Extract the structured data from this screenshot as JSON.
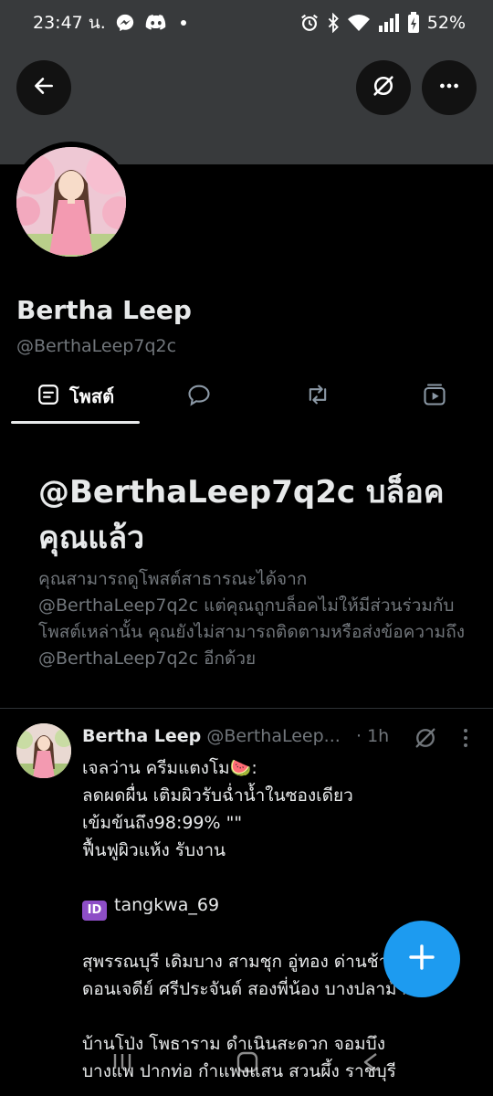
{
  "status_bar": {
    "time": "23:47 น.",
    "battery": "52%",
    "icons_left": [
      "messenger-icon",
      "discord-icon",
      "dot-icon"
    ],
    "icons_right": [
      "alarm-icon",
      "bluetooth-icon",
      "wifi-icon",
      "signal-icon",
      "battery-icon"
    ]
  },
  "header": {
    "back_icon": "back-arrow-icon",
    "mute_icon": "muted-notification-icon",
    "more_icon": "more-horizontal-icon"
  },
  "profile": {
    "display_name": "Bertha Leep",
    "handle": "@BerthaLeep7q2c"
  },
  "tabs": [
    {
      "label": "โพสต์",
      "icon": "posts-icon",
      "active": true
    },
    {
      "label": "",
      "icon": "replies-icon",
      "active": false
    },
    {
      "label": "",
      "icon": "reposts-icon",
      "active": false
    },
    {
      "label": "",
      "icon": "media-icon",
      "active": false
    }
  ],
  "blocked_notice": {
    "title": "@BerthaLeep7q2c บล็อคคุณแล้ว",
    "body": "คุณสามารถดูโพสต์สาธารณะได้จาก @BerthaLeep7q2c แต่คุณถูกบล็อคไม่ให้มีส่วนร่วมกับโพสต์เหล่านั้น คุณยังไม่สามารถติดตามหรือส่งข้อความถึง @BerthaLeep7q2c อีกด้วย"
  },
  "post": {
    "author_name": "Bertha Leep",
    "author_handle": "@BerthaLeep...",
    "time": "· 1h",
    "lines": [
      "เจลว่าน ครีมแตงโม🍉:",
      "ลดผดผื่น เติมผิวรับฉ่ำน้ำในซองเดียว",
      "เข้มข้นถึง98:99% \"\"",
      "ฟื้นฟูผิวแห้ง รับงาน",
      "",
      "tangkwa_69",
      "",
      "สุพรรณบุรี เดิมบาง สามชุก อู่ทอง ด่านช้าง",
      "ดอนเจดีย์ ศรีประจันต์ สองพี่น้อง บางปลาม้า",
      "",
      "บ้านโป่ง โพธาราม ดำเนินสะดวก จอมบึง",
      "บางแพ ปากท่อ กำแพงแสน สวนผึ้ง ราชบุรี"
    ],
    "id_badge": "ID"
  },
  "fab": {
    "icon": "plus-icon"
  },
  "navbar": {
    "icons": [
      "recent-apps-icon",
      "home-icon",
      "back-icon"
    ]
  },
  "colors": {
    "accent": "#1d9bf0",
    "muted_text": "#71767b",
    "banner": "#383a3c"
  }
}
